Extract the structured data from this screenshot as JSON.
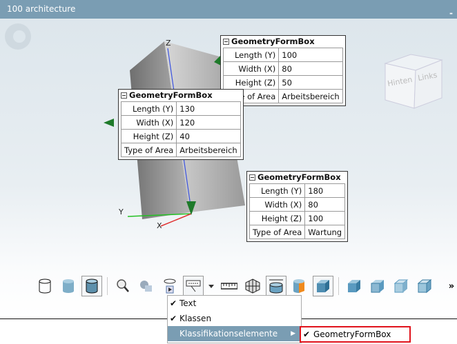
{
  "window": {
    "title": "100 architecture",
    "minimize_label": "-"
  },
  "viewcube": {
    "faces": [
      "Hinten",
      "Links"
    ]
  },
  "axes": {
    "z": "Z",
    "y": "Y",
    "x": "X"
  },
  "formboxes": [
    {
      "title": "GeometryFormBox",
      "rows": [
        [
          "Length (Y)",
          "100"
        ],
        [
          "Width (X)",
          "80"
        ],
        [
          "Height (Z)",
          "50"
        ],
        [
          "Type of Area",
          "Arbeitsbereich"
        ]
      ]
    },
    {
      "title": "GeometryFormBox",
      "rows": [
        [
          "Length (Y)",
          "130"
        ],
        [
          "Width (X)",
          "120"
        ],
        [
          "Height (Z)",
          "40"
        ],
        [
          "Type of Area",
          "Arbeitsbereich"
        ]
      ]
    },
    {
      "title": "GeometryFormBox",
      "rows": [
        [
          "Length (Y)",
          "180"
        ],
        [
          "Width (X)",
          "80"
        ],
        [
          "Height (Z)",
          "100"
        ],
        [
          "Type of Area",
          "Wartung"
        ]
      ]
    }
  ],
  "toolbar": {
    "overflow_label": "»"
  },
  "menu": {
    "items": [
      {
        "label": "Text",
        "checked": true
      },
      {
        "label": "Klassen",
        "checked": true
      },
      {
        "label": "Klassifikationselemente",
        "checked": false,
        "submenu": true
      }
    ],
    "check": "✔",
    "arrow": "▶"
  },
  "submenu": {
    "items": [
      {
        "label": "GeometryFormBox",
        "checked": true
      }
    ],
    "highlight_color": "#e0121b"
  },
  "colors": {
    "titlebar": "#7a9db3",
    "menu_selected": "#7a9db3"
  }
}
